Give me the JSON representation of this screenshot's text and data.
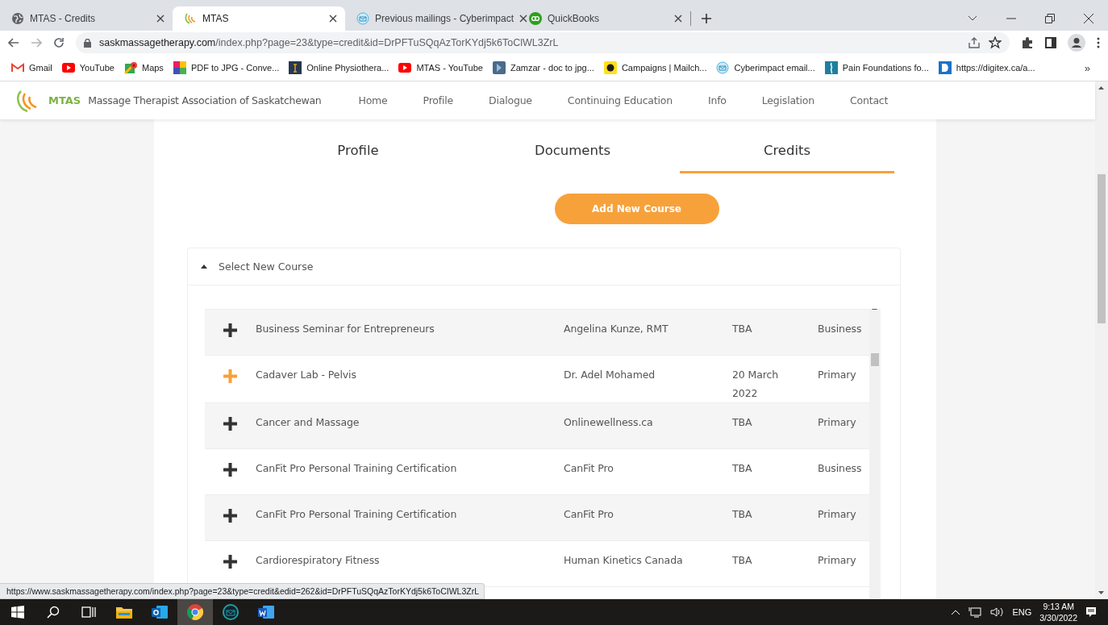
{
  "browser": {
    "tabs": [
      {
        "title": "MTAS - Credits",
        "selected": false
      },
      {
        "title": "MTAS",
        "selected": true
      },
      {
        "title": "Previous mailings - Cyberimpact",
        "selected": false
      },
      {
        "title": "QuickBooks",
        "selected": false
      }
    ],
    "url_host": "saskmassagetherapy.com",
    "url_path": "/index.php?page=23&type=credit&id=DrPFTuSQqAzTorKYdj5k6ToClWL3ZrL",
    "bookmarks": [
      "Gmail",
      "YouTube",
      "Maps",
      "PDF to JPG - Conve...",
      "Online Physiothera...",
      "MTAS - YouTube",
      "Zamzar - doc to jpg...",
      "Campaigns | Mailch...",
      "Cyberimpact email...",
      "Pain Foundations fo...",
      "https://digitex.ca/a..."
    ],
    "bookmarks_more": "»",
    "status_url": "https://www.saskmassagetherapy.com/index.php?page=23&type=credit&edid=262&id=DrPFTuSQqAzTorKYdj5k6ToCIWL3ZrL"
  },
  "site": {
    "brand": "MTAS",
    "org_name": "Massage Therapist Association of Saskatchewan",
    "nav": [
      "Home",
      "Profile",
      "Dialogue",
      "Continuing Education",
      "Info",
      "Legislation",
      "Contact"
    ],
    "tabs": [
      {
        "label": "Profile",
        "selected": false
      },
      {
        "label": "Documents",
        "selected": false
      },
      {
        "label": "Credits",
        "selected": true
      }
    ],
    "add_button": "Add New Course",
    "panel": {
      "title": "Select New Course",
      "expanded": true
    },
    "courses": [
      {
        "name": "Business Seminar for Entrepreneurs",
        "instructor": "Angelina Kunze, RMT",
        "date": "TBA",
        "category": "Business",
        "hovered": false
      },
      {
        "name": "Cadaver Lab - Pelvis",
        "instructor": "Dr. Adel Mohamed",
        "date": "20 March 2022",
        "category": "Primary",
        "hovered": true
      },
      {
        "name": "Cancer and Massage",
        "instructor": "Onlinewellness.ca",
        "date": "TBA",
        "category": "Primary",
        "hovered": false
      },
      {
        "name": "CanFit Pro Personal Training Certification",
        "instructor": "CanFit Pro",
        "date": "TBA",
        "category": "Business",
        "hovered": false
      },
      {
        "name": "CanFit Pro Personal Training Certification",
        "instructor": "CanFit Pro",
        "date": "TBA",
        "category": "Primary",
        "hovered": false
      },
      {
        "name": "Cardiorespiratory Fitness",
        "instructor": "Human Kinetics Canada",
        "date": "TBA",
        "category": "Primary",
        "hovered": false
      }
    ]
  },
  "taskbar": {
    "language": "ENG",
    "time": "9:13 AM",
    "date": "3/30/2022"
  }
}
